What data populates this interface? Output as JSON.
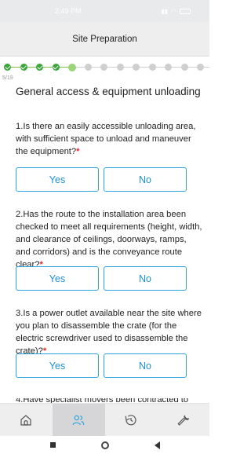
{
  "status_bar": {
    "time": "2:49 PM",
    "icons": [
      "gallery-icon",
      "image-icon",
      "settings-icon",
      "alarm-icon",
      "signal-icon",
      "wifi-icon",
      "battery-icon"
    ]
  },
  "header": {
    "title": "Site Preparation"
  },
  "progress": {
    "counter": "5/19",
    "current_step": 5,
    "total_steps": 19
  },
  "section": {
    "title": "General access & equipment unloading"
  },
  "questions": [
    {
      "text": "1.Is there an easily accessible unloading area, with sufficient space to unload and maneuver the equipment?",
      "required_mark": "*"
    },
    {
      "text": "2.Has the route to the installation area been checked to meet all requirements (height, width, and clearance of ceilings, doorways, ramps, and corridors) and is the conveyance route clear?",
      "required_mark": "*"
    },
    {
      "text": "3.Is a power outlet available near the site where you plan to disassemble the crate (for the electric screwdriver used to disassemble the crate)?",
      "required_mark": "*"
    },
    {
      "text": "4.Have specialist movers been contracted to"
    }
  ],
  "answers": {
    "yes": "Yes",
    "no": "No"
  },
  "bottom_nav": [
    {
      "name": "home-icon",
      "active": false
    },
    {
      "name": "people-icon",
      "active": true
    },
    {
      "name": "history-icon",
      "active": false
    },
    {
      "name": "wrench-icon",
      "active": false
    }
  ],
  "colors": {
    "accent": "#2fa4dd",
    "done": "#3aa53a",
    "required": "#e0262a"
  }
}
